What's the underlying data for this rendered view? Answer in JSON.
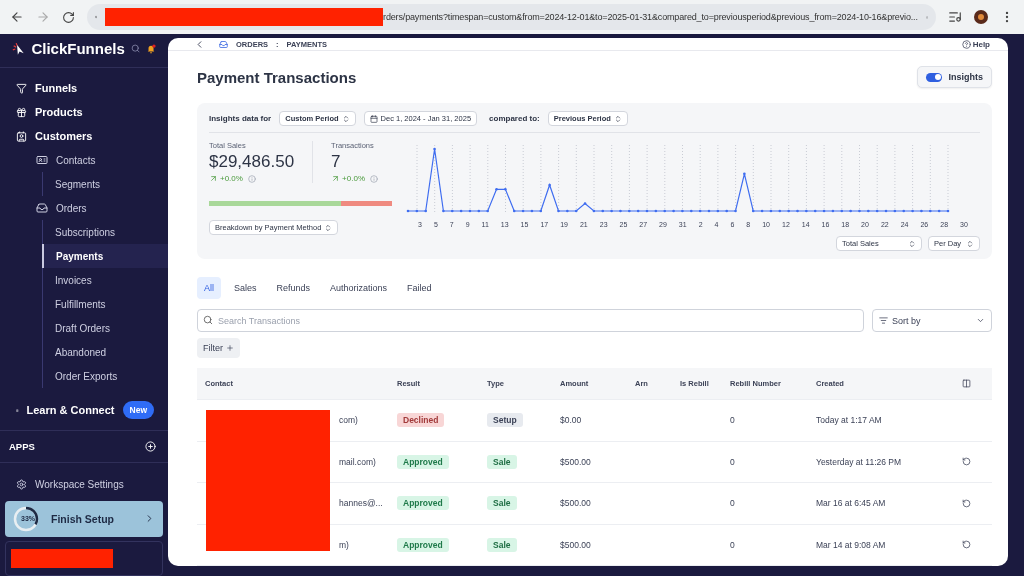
{
  "browser": {
    "url": "rders/payments?timespan=custom&from=2024-12-01&to=2025-01-31&compared_to=previousperiod&previous_from=2024-10-16&previo..."
  },
  "sidebar": {
    "brand": "ClickFunnels",
    "items": [
      {
        "label": "Funnels",
        "selected": false
      },
      {
        "label": "Products",
        "selected": false
      },
      {
        "label": "Customers",
        "selected": false,
        "children": [
          {
            "label": "Contacts",
            "selected": false,
            "children": [
              {
                "label": "Segments",
                "selected": false
              }
            ]
          },
          {
            "label": "Orders",
            "selected": false,
            "children": [
              {
                "label": "Subscriptions",
                "selected": false
              },
              {
                "label": "Payments",
                "selected": true
              },
              {
                "label": "Invoices",
                "selected": false
              },
              {
                "label": "Fulfillments",
                "selected": false
              },
              {
                "label": "Draft Orders",
                "selected": false
              },
              {
                "label": "Abandoned",
                "selected": false
              },
              {
                "label": "Order Exports",
                "selected": false
              }
            ]
          }
        ]
      },
      {
        "label": "Learn & Connect",
        "selected": false,
        "badge": "New"
      }
    ],
    "apps_label": "APPS",
    "settings": "Workspace Settings",
    "setup": {
      "label": "Finish Setup",
      "percent": "33%",
      "level": 0.33
    }
  },
  "breadcrumb": [
    "ORDERS",
    "PAYMENTS"
  ],
  "breadcrumb_separator": ":",
  "help": "Help",
  "title": "Payment Transactions",
  "insights_toggle": {
    "label": "Insights",
    "on": true
  },
  "insights": {
    "lead": "Insights data for",
    "period": "Custom Period",
    "range": "Dec 1, 2024 - Jan 31, 2025",
    "compared_label": "compared to:",
    "compared": "Previous Period",
    "metrics": [
      {
        "label": "Total Sales",
        "value": "$29,486.50",
        "change": "+0.0%"
      },
      {
        "label": "Transactions",
        "value": "7",
        "change": "+0.0%"
      }
    ],
    "split": {
      "level": 0.72
    },
    "breakdown": "Breakdown by Payment Method",
    "x_labels": [
      "3",
      "5",
      "7",
      "9",
      "11",
      "13",
      "15",
      "17",
      "19",
      "21",
      "23",
      "25",
      "27",
      "29",
      "31",
      "2",
      "4",
      "6",
      "8",
      "10",
      "12",
      "14",
      "16",
      "18",
      "20",
      "22",
      "24",
      "26",
      "28",
      "30"
    ],
    "metric_select": "Total Sales",
    "interval_select": "Per Day"
  },
  "tabs": [
    {
      "label": "All",
      "selected": true
    },
    {
      "label": "Sales",
      "selected": false
    },
    {
      "label": "Refunds",
      "selected": false
    },
    {
      "label": "Authorizations",
      "selected": false
    },
    {
      "label": "Failed",
      "selected": false
    }
  ],
  "search": {
    "placeholder": "Search Transactions"
  },
  "sort": "Sort by",
  "filter": "Filter",
  "table": {
    "columns": [
      "Contact",
      "Result",
      "Type",
      "Amount",
      "Arn",
      "Is Rebill",
      "Rebill Number",
      "Created"
    ],
    "rows": [
      {
        "contact": "com)",
        "result": {
          "text": "Declined",
          "kind": "declined"
        },
        "type": {
          "text": "Setup",
          "kind": "setup"
        },
        "amount": "$0.00",
        "rebill_number": "0",
        "created": "Today at 1:17 AM",
        "refundable": false
      },
      {
        "contact": "mail.com)",
        "result": {
          "text": "Approved",
          "kind": "approved"
        },
        "type": {
          "text": "Sale",
          "kind": "sale"
        },
        "amount": "$500.00",
        "rebill_number": "0",
        "created": "Yesterday at 11:26 PM",
        "refundable": true
      },
      {
        "contact": "hannes@...",
        "result": {
          "text": "Approved",
          "kind": "approved"
        },
        "type": {
          "text": "Sale",
          "kind": "sale"
        },
        "amount": "$500.00",
        "rebill_number": "0",
        "created": "Mar 16 at 6:45 AM",
        "refundable": true
      },
      {
        "contact": "m)",
        "result": {
          "text": "Approved",
          "kind": "approved"
        },
        "type": {
          "text": "Sale",
          "kind": "sale"
        },
        "amount": "$500.00",
        "rebill_number": "0",
        "created": "Mar 14 at 9:08 AM",
        "refundable": true
      }
    ]
  }
}
